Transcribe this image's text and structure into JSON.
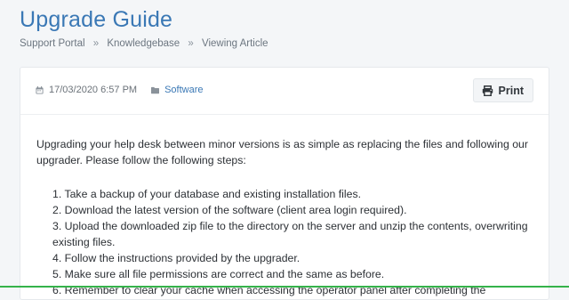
{
  "page": {
    "title": "Upgrade Guide"
  },
  "breadcrumb": {
    "items": [
      "Support Portal",
      "Knowledgebase",
      "Viewing Article"
    ],
    "separator": "»"
  },
  "article": {
    "date": "17/03/2020 6:57 PM",
    "category": "Software",
    "print_label": "Print",
    "intro": "Upgrading your help desk between minor versions is as simple as replacing the files and following our upgrader. Please follow the following steps:",
    "steps": [
      "1. Take a backup of your database and existing installation files.",
      "2. Download the latest version of the software (client area login required).",
      "3. Upload the downloaded zip file to the directory on the server and unzip the contents, overwriting existing files.",
      "4. Follow the instructions provided by the upgrader.",
      "5. Make sure all file permissions are correct and the same as before.",
      "6. Remember to clear your cache when accessing the operator panel after completing the"
    ]
  },
  "icons": {
    "date": "calendar-icon",
    "category": "folder-icon",
    "print": "printer-icon"
  },
  "colors": {
    "accent": "#3a78b5",
    "background": "#f4f6f8",
    "bottom_bar": "#35b34a"
  }
}
